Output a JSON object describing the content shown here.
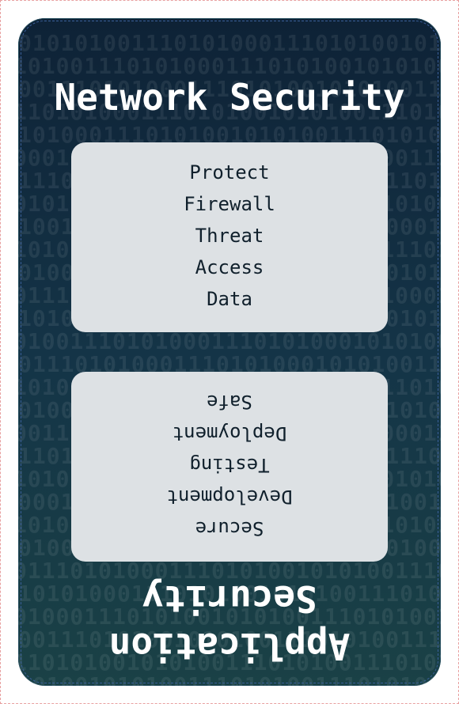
{
  "top_section": {
    "title": "Network Security",
    "items": [
      "Protect",
      "Firewall",
      "Threat",
      "Access",
      "Data"
    ]
  },
  "bottom_section": {
    "title": "Application Security",
    "items": [
      "Secure",
      "Development",
      "Testing",
      "Deployment",
      "Safe"
    ]
  },
  "background_pattern": "01010100111010100011101010010101001110101001110101000111010100",
  "colors": {
    "card_top": "#0e2236",
    "card_bottom": "#1a4146",
    "panel": "#dde1e4",
    "title_text": "#ffffff",
    "item_text": "#10202c"
  }
}
